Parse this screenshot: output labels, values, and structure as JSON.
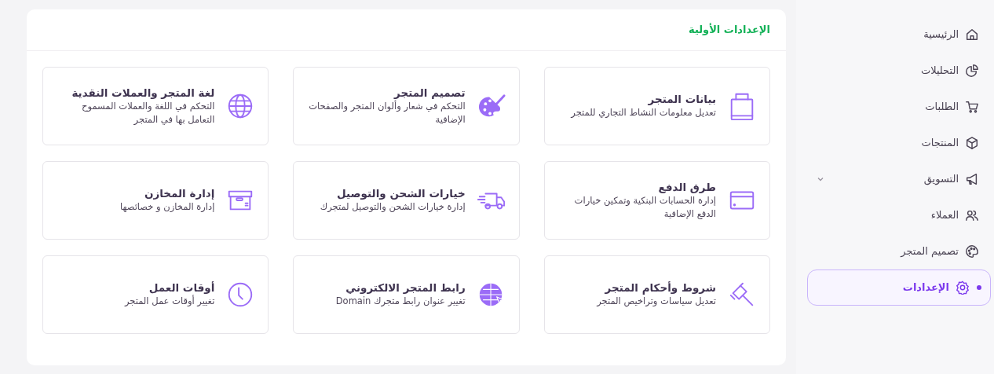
{
  "sidebar": {
    "items": [
      {
        "label": "الرئيسية",
        "selected": false,
        "has_submenu": false
      },
      {
        "label": "التحليلات",
        "selected": false,
        "has_submenu": false
      },
      {
        "label": "الطلبات",
        "selected": false,
        "has_submenu": false
      },
      {
        "label": "المنتجات",
        "selected": false,
        "has_submenu": false
      },
      {
        "label": "التسويق",
        "selected": false,
        "has_submenu": true
      },
      {
        "label": "العملاء",
        "selected": false,
        "has_submenu": false
      },
      {
        "label": "تصميم المتجر",
        "selected": false,
        "has_submenu": false
      },
      {
        "label": "الإعدادات",
        "selected": true,
        "has_submenu": false
      }
    ]
  },
  "panel": {
    "title": "الإعدادات الأولية",
    "cards": [
      {
        "title": "بيانات المتجر",
        "description": "تعديل معلومات النشاط التجاري للمتجر"
      },
      {
        "title": "تصميم المتجر",
        "description": "التحكم في شعار وألوان المتجر والصفحات الإضافية"
      },
      {
        "title": "لغة المتجر والعملات النقدية",
        "description": "التحكم في اللغة والعملات المسموح التعامل بها في المتجر"
      },
      {
        "title": "طرق الدفع",
        "description": "إدارة الحسابات البنكية وتمكين خيارات الدفع الإضافية"
      },
      {
        "title": "خيارات الشحن والتوصيل",
        "description": "إدارة خيارات الشحن والتوصيل لمتجرك"
      },
      {
        "title": "إدارة المخازن",
        "description": "إدارة المخازن و خصائصها"
      },
      {
        "title": "شروط وأحكام المتجر",
        "description": "تعديل سياسات وتراخيص المتجر"
      },
      {
        "title": "رابط المتجر الالكتروني",
        "description": "تغيير عنوان رابط متجرك Domain"
      },
      {
        "title": "أوقات العمل",
        "description": "تغيير أوقات عمل المتجر"
      }
    ]
  }
}
